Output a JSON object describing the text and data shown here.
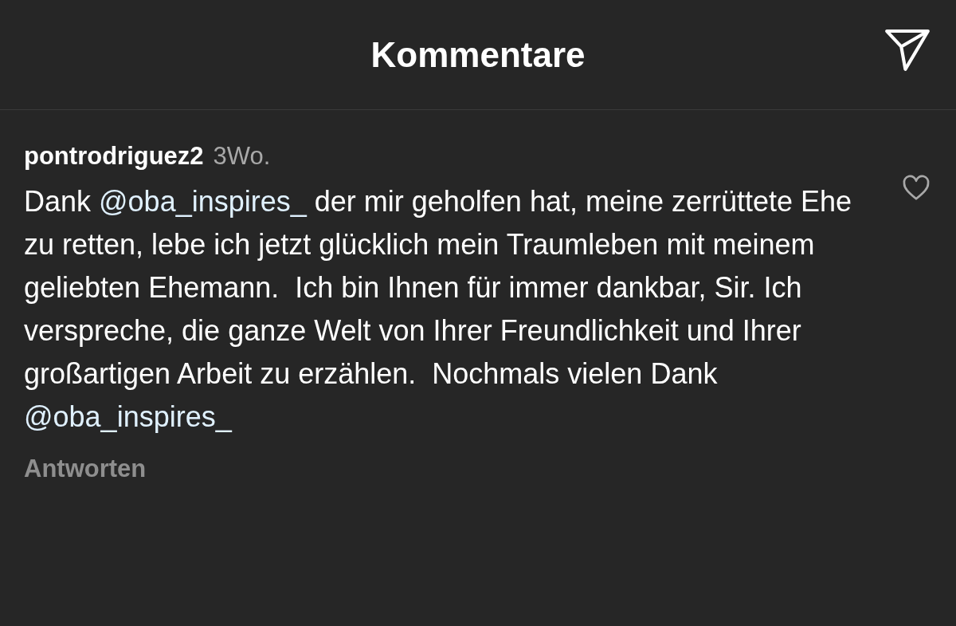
{
  "header": {
    "title": "Kommentare"
  },
  "comment": {
    "username": "pontrodriguez2",
    "time": "3Wo.",
    "liked": false,
    "body": [
      {
        "kind": "text",
        "text": "Dank "
      },
      {
        "kind": "mention",
        "text": "@oba_inspires_"
      },
      {
        "kind": "text",
        "text": " der mir geholfen hat, meine zerrüttete Ehe zu retten, lebe ich jetzt glücklich mein Traumleben mit meinem geliebten Ehemann.  Ich bin Ihnen für immer dankbar, Sir. Ich verspreche, die ganze Welt von Ihrer Freundlichkeit und Ihrer großartigen Arbeit zu erzählen.  Nochmals vielen Dank "
      },
      {
        "kind": "mention",
        "text": "@oba_inspires_"
      }
    ],
    "reply": "Antworten"
  }
}
